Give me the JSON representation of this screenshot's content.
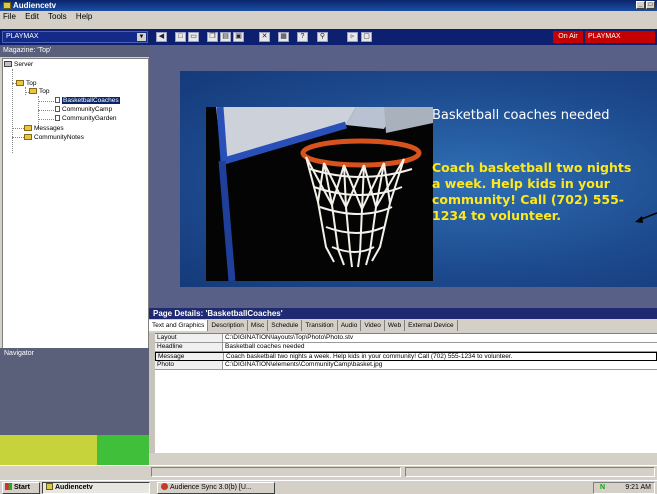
{
  "window": {
    "title": "Audiencetv"
  },
  "menu": [
    "File",
    "Edit",
    "Tools",
    "Help"
  ],
  "toolbar": {
    "playlist_dropdown": "PLAYMAX",
    "on_air_label": "On Air",
    "channel_label": "PLAYMAX",
    "icons": [
      "back-icon",
      "new-icon",
      "open-icon",
      "copy-icon",
      "paste-icon",
      "window-icon",
      "delete-icon",
      "properties-icon",
      "help-icon",
      "find-icon",
      "preview-icon",
      "display-icon"
    ]
  },
  "sidebar": {
    "header": "Magazine: 'Top'",
    "tree": {
      "root": "Server",
      "level1": "Top",
      "level2": "Top",
      "pages": [
        "BasketballCoaches",
        "CommunityCamp",
        "CommunityGarden"
      ],
      "siblings": [
        "Messages",
        "CommunityNotes"
      ]
    },
    "selected": "BasketballCoaches",
    "navigator_label": "Navigator",
    "colors": {
      "yellow": "#c7d33a",
      "green": "#3fbf3a"
    }
  },
  "slide": {
    "headline": "Basketball coaches needed",
    "message": "Coach basketball two nights a week. Help kids in your community! Call (702) 555-1234 to volunteer.",
    "headline_color": "#ffffff",
    "message_color": "#ffe81a"
  },
  "details": {
    "header": "Page Details: 'BasketballCoaches'",
    "tabs": [
      "Text and Graphics",
      "Description",
      "Misc",
      "Schedule",
      "Transition",
      "Audio",
      "Video",
      "Web",
      "External Device"
    ],
    "active_tab": "Text and Graphics",
    "rows": [
      {
        "key": "Layout",
        "value": "C:\\DIGINATION\\layouts\\Top\\Photo\\Photo.stv"
      },
      {
        "key": "Headline",
        "value": "Basketball coaches needed"
      },
      {
        "key": "Message",
        "value": "Coach basketball two nights a week. Help kids in your community! Call (702) 555-1234 to volunteer."
      },
      {
        "key": "Photo",
        "value": "C:\\DIGINATION\\elements\\CommunityCamp\\basket.jpg"
      }
    ]
  },
  "taskbar": {
    "start_label": "Start",
    "active_task": "Audiencetv",
    "other_task": "Audience Sync 3.0(b) [U...",
    "tray_letter": "N",
    "clock": "9:21 AM"
  }
}
